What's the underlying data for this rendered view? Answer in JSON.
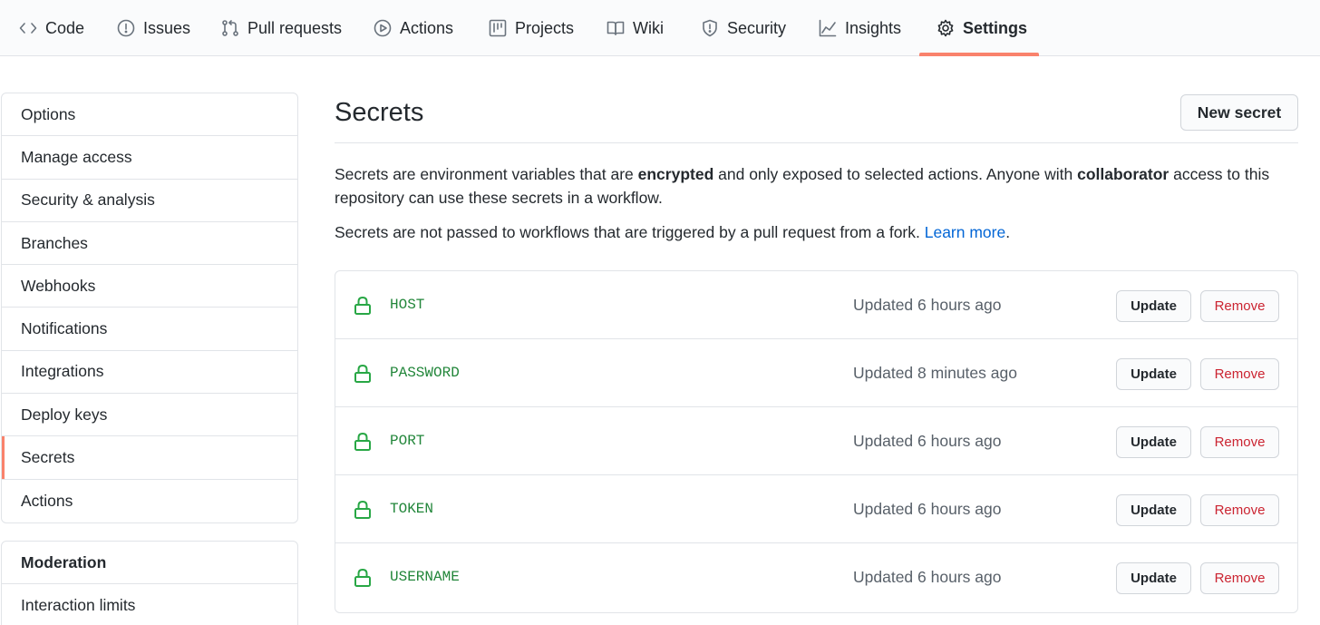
{
  "repo_nav": {
    "tabs": [
      {
        "label": "Code",
        "icon": "code-icon"
      },
      {
        "label": "Issues",
        "icon": "issue-opened-icon"
      },
      {
        "label": "Pull requests",
        "icon": "git-pull-request-icon"
      },
      {
        "label": "Actions",
        "icon": "play-icon"
      },
      {
        "label": "Projects",
        "icon": "project-icon"
      },
      {
        "label": "Wiki",
        "icon": "book-icon"
      },
      {
        "label": "Security",
        "icon": "shield-icon"
      },
      {
        "label": "Insights",
        "icon": "graph-icon"
      },
      {
        "label": "Settings",
        "icon": "gear-icon"
      }
    ],
    "active_tab": "Settings",
    "active_color": "#f9826c"
  },
  "sidebar": {
    "items": [
      {
        "label": "Options"
      },
      {
        "label": "Manage access"
      },
      {
        "label": "Security & analysis"
      },
      {
        "label": "Branches"
      },
      {
        "label": "Webhooks"
      },
      {
        "label": "Notifications"
      },
      {
        "label": "Integrations"
      },
      {
        "label": "Deploy keys"
      },
      {
        "label": "Secrets"
      },
      {
        "label": "Actions"
      }
    ],
    "selected": "Secrets",
    "moderation": {
      "heading": "Moderation",
      "items": [
        {
          "label": "Interaction limits"
        }
      ]
    }
  },
  "main": {
    "title": "Secrets",
    "new_secret_label": "New secret",
    "description": {
      "p1_a": "Secrets are environment variables that are ",
      "p1_b": "encrypted",
      "p1_c": " and only exposed to selected actions. Anyone with ",
      "p1_d": "collaborator",
      "p1_e": " access to this repository can use these secrets in a workflow.",
      "p2_a": "Secrets are not passed to workflows that are triggered by a pull request from a fork. ",
      "p2_link": "Learn more",
      "p2_end": "."
    },
    "secrets": [
      {
        "name": "HOST",
        "updated": "Updated 6 hours ago"
      },
      {
        "name": "PASSWORD",
        "updated": "Updated 8 minutes ago"
      },
      {
        "name": "PORT",
        "updated": "Updated 6 hours ago"
      },
      {
        "name": "TOKEN",
        "updated": "Updated 6 hours ago"
      },
      {
        "name": "USERNAME",
        "updated": "Updated 6 hours ago"
      }
    ],
    "update_label": "Update",
    "remove_label": "Remove",
    "colors": {
      "secret_name": "#22863a",
      "lock": "#28a745",
      "remove": "#cb2431",
      "link": "#0366d6"
    }
  }
}
